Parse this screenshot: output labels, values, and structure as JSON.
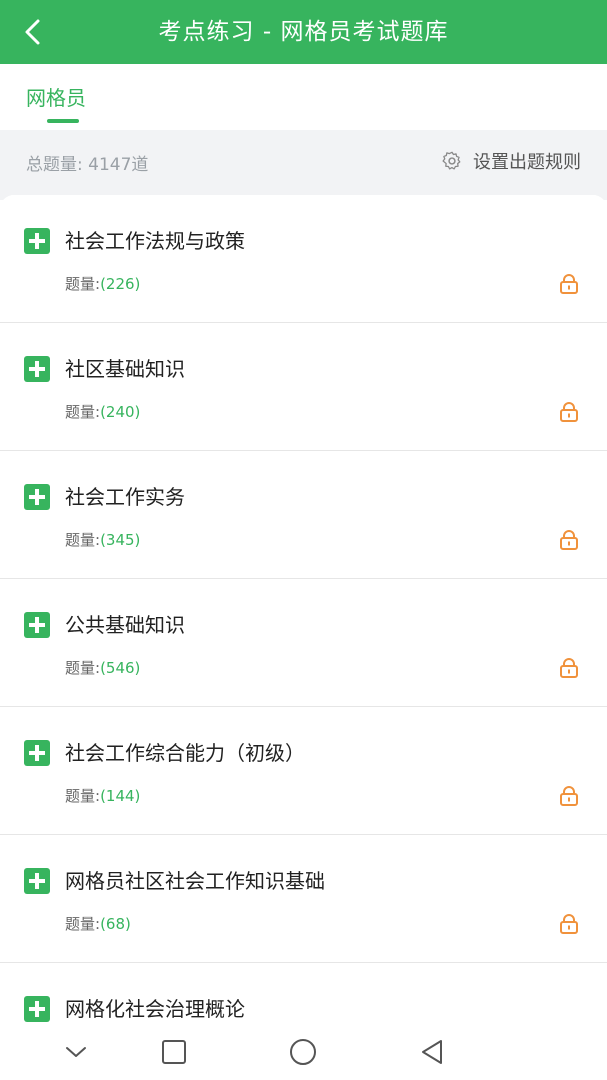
{
  "header": {
    "title": "考点练习 - 网格员考试题库"
  },
  "tabs": [
    {
      "label": "网格员"
    }
  ],
  "summary": {
    "total_label": "总题量:",
    "total_value": "4147道",
    "rules_label": "设置出题规则"
  },
  "count_label": "题量:",
  "items": [
    {
      "title": "社会工作法规与政策",
      "count": "(226)"
    },
    {
      "title": "社区基础知识",
      "count": "(240)"
    },
    {
      "title": "社会工作实务",
      "count": "(345)"
    },
    {
      "title": "公共基础知识",
      "count": "(546)"
    },
    {
      "title": "社会工作综合能力（初级）",
      "count": "(144)"
    },
    {
      "title": "网格员社区社会工作知识基础",
      "count": "(68)"
    },
    {
      "title": "网格化社会治理概论",
      "count": ""
    }
  ],
  "colors": {
    "accent": "#37b45e",
    "lock": "#f0923c"
  }
}
